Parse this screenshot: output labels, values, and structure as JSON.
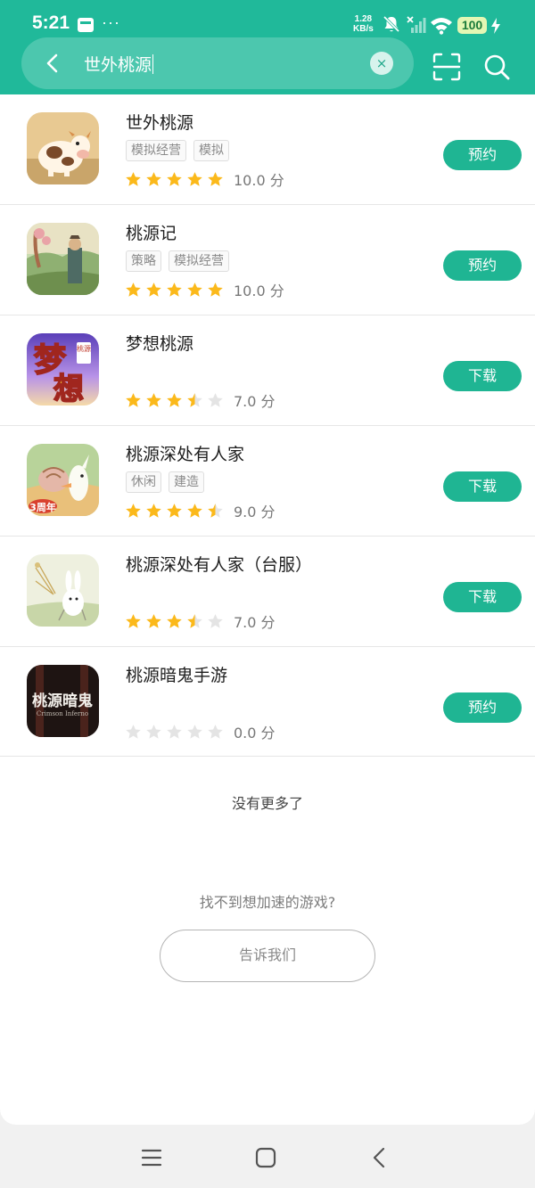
{
  "status_bar": {
    "time": "5:21",
    "net_speed_value": "1.28",
    "net_speed_unit": "KB/s",
    "battery": "100",
    "more_dots": "···"
  },
  "search": {
    "query": "世外桃源",
    "clear_glyph": "×"
  },
  "results": [
    {
      "name": "世外桃源",
      "tags": [
        "模拟经营",
        "模拟"
      ],
      "rating": 5,
      "score": "10.0 分",
      "action": "预约",
      "icon": "cow-game-icon"
    },
    {
      "name": "桃源记",
      "tags": [
        "策略",
        "模拟经营"
      ],
      "rating": 5,
      "score": "10.0 分",
      "action": "预约",
      "icon": "village-game-icon"
    },
    {
      "name": "梦想桃源",
      "tags": [],
      "rating": 3.5,
      "score": "7.0 分",
      "action": "下载",
      "icon": "dream-game-icon"
    },
    {
      "name": "桃源深处有人家",
      "tags": [
        "休闲",
        "建造"
      ],
      "rating": 4.5,
      "score": "9.0 分",
      "action": "下载",
      "icon": "bird-game-icon"
    },
    {
      "name": "桃源深处有人家（台服）",
      "tags": [],
      "rating": 3.5,
      "score": "7.0 分",
      "action": "下载",
      "icon": "rabbit-game-icon"
    },
    {
      "name": "桃源暗鬼手游",
      "tags": [],
      "rating": 0,
      "score": "0.0 分",
      "action": "预约",
      "icon": "dark-game-icon"
    }
  ],
  "icon_text": {
    "dream_title": "梦",
    "dream_title2": "想",
    "dream_badge": "桃源",
    "bird_badge": "3周年",
    "dark_title": "桃源暗鬼",
    "dark_subtitle": "Crimson Inferno"
  },
  "footer": {
    "no_more": "没有更多了",
    "not_found": "找不到想加速的游戏?",
    "tell_us": "告诉我们"
  },
  "colors": {
    "header": "#20b99a",
    "button": "#1fb593",
    "star_filled": "#fbb91b",
    "star_empty": "#e4e4e4"
  }
}
